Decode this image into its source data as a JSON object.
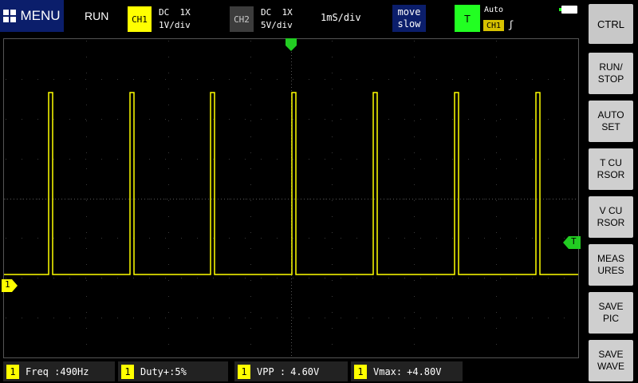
{
  "header": {
    "menu_label": "MENU",
    "run_status": "RUN",
    "ch1": {
      "badge": "CH1",
      "coupling": "DC  1X",
      "scale": "1V/div",
      "color": "#ffff00"
    },
    "ch2": {
      "badge": "CH2",
      "coupling": "DC  1X",
      "scale": "5V/div",
      "color": "#3c3c3c"
    },
    "timebase": "1mS/div",
    "move": {
      "line1": "move",
      "line2": "slow"
    },
    "trigger": {
      "badge": "T",
      "mode": "Auto",
      "source": "CH1",
      "edge": "ʃ"
    }
  },
  "sidebar": {
    "buttons": [
      {
        "name": "ctrl",
        "label": "CTRL"
      },
      {
        "name": "run-stop",
        "label": "RUN/\nSTOP"
      },
      {
        "name": "auto-set",
        "label": "AUTO\nSET"
      },
      {
        "name": "t-cursor",
        "label": "T CU\nRSOR"
      },
      {
        "name": "v-cursor",
        "label": "V CU\nRSOR"
      },
      {
        "name": "measures",
        "label": "MEAS\nURES"
      },
      {
        "name": "save-pic",
        "label": "SAVE\nPIC"
      },
      {
        "name": "save-wave",
        "label": "SAVE\nWAVE"
      }
    ]
  },
  "markers": {
    "ch1": "1",
    "trigger": "T"
  },
  "measures": [
    {
      "ch": "1",
      "label": "Freq :",
      "value": "490Hz"
    },
    {
      "ch": "1",
      "label": "Duty+:",
      "value": "5%"
    },
    {
      "ch": "1",
      "label": "VPP  :",
      "value": "4.60V"
    },
    {
      "ch": "1",
      "label": "Vmax:",
      "value": "+4.80V"
    }
  ],
  "trace": {
    "color": "#ffff00",
    "grid_color": "#3a3a3a"
  }
}
